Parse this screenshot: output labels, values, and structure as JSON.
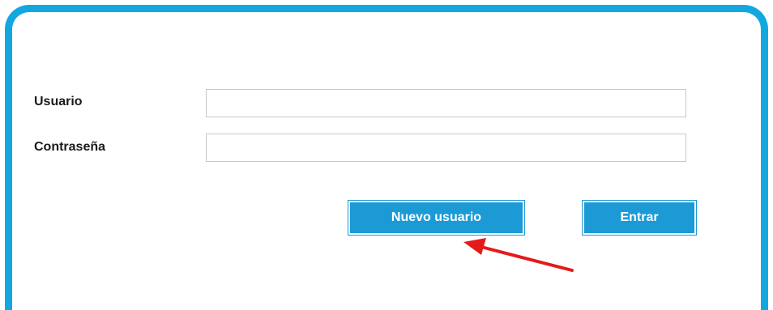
{
  "form": {
    "username_label": "Usuario",
    "username_value": "",
    "password_label": "Contraseña",
    "password_value": ""
  },
  "buttons": {
    "new_user_label": "Nuevo usuario",
    "enter_label": "Entrar"
  },
  "colors": {
    "frame_border": "#12a8df",
    "button_background": "#1c9ad6",
    "annotation_arrow": "#e41a1a"
  },
  "annotation": {
    "icon": "red-arrow-icon"
  }
}
